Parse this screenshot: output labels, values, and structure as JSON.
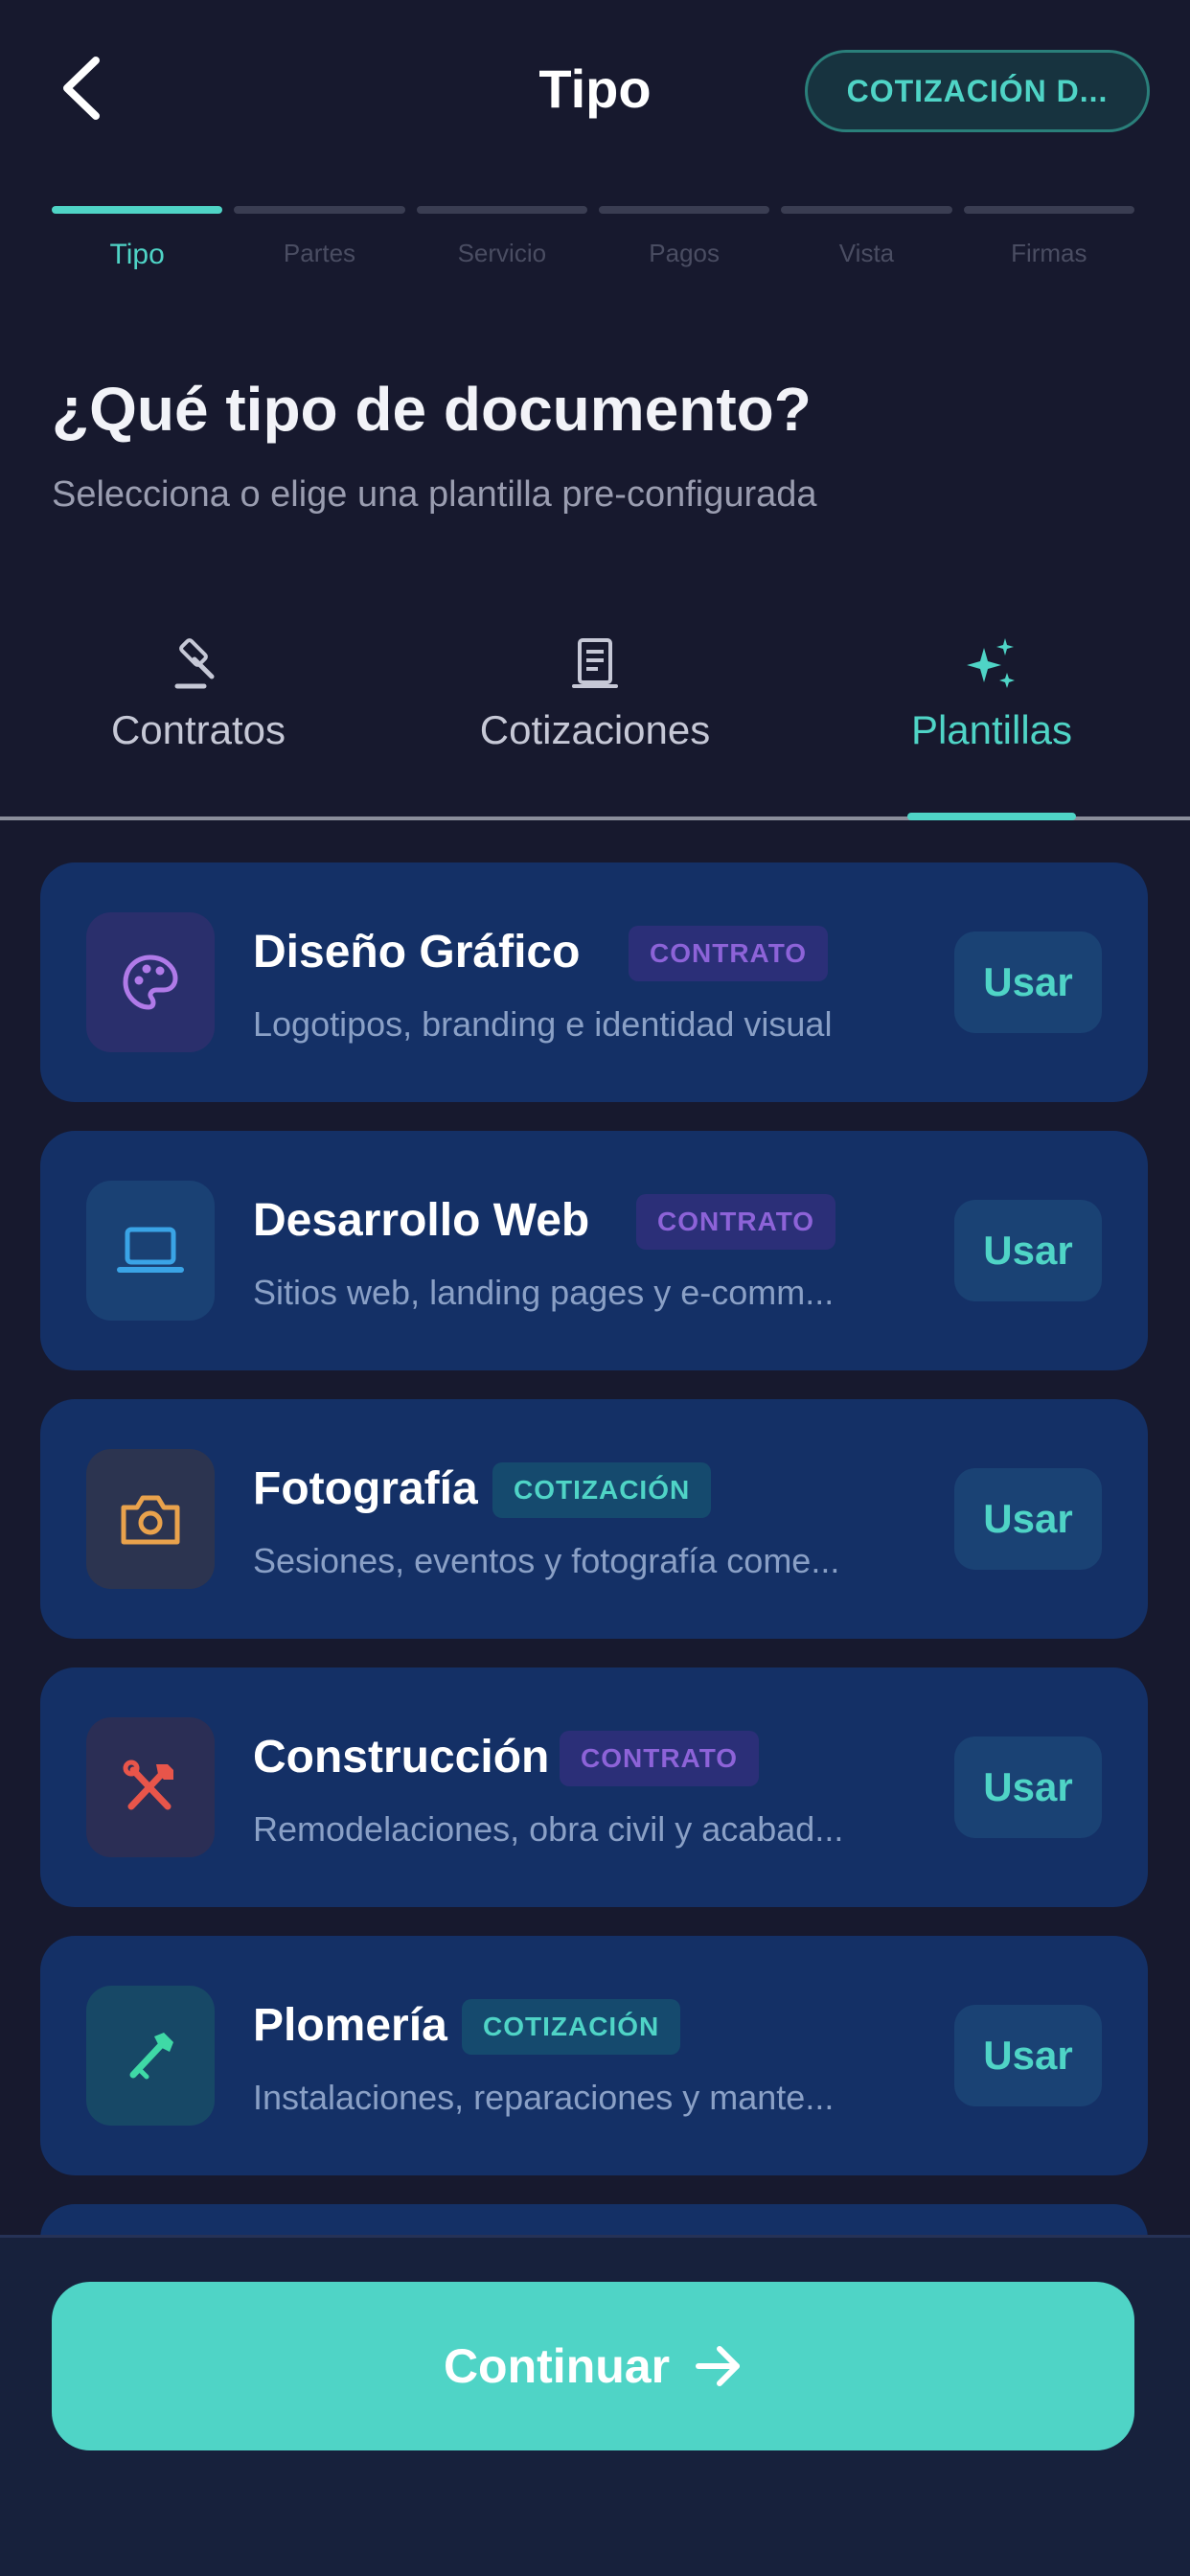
{
  "header": {
    "title": "Tipo",
    "doc_pill": "COTIZACIÓN D..."
  },
  "stepper": {
    "steps": [
      "Tipo",
      "Partes",
      "Servicio",
      "Pagos",
      "Vista",
      "Firmas"
    ],
    "active_index": 0
  },
  "intro": {
    "heading": "¿Qué tipo de documento?",
    "subheading": "Selecciona o elige una plantilla pre-configurada"
  },
  "tabs": [
    {
      "label": "Contratos",
      "icon": "gavel-icon"
    },
    {
      "label": "Cotizaciones",
      "icon": "document-icon"
    },
    {
      "label": "Plantillas",
      "icon": "sparkles-icon",
      "active": true
    }
  ],
  "templates": [
    {
      "title": "Diseño Gráfico",
      "badge": "CONTRATO",
      "desc": "Logotipos, branding e identidad visual",
      "icon": "palette-icon",
      "action": "Usar"
    },
    {
      "title": "Desarrollo Web",
      "badge": "CONTRATO",
      "desc": "Sitios web, landing pages y e-comm...",
      "icon": "laptop-icon",
      "action": "Usar"
    },
    {
      "title": "Fotografía",
      "badge": "COTIZACIÓN",
      "desc": "Sesiones, eventos y fotografía come...",
      "icon": "camera-icon",
      "action": "Usar"
    },
    {
      "title": "Construcción",
      "badge": "CONTRATO",
      "desc": "Remodelaciones, obra civil y acabad...",
      "icon": "tools-icon",
      "action": "Usar"
    },
    {
      "title": "Plomería",
      "badge": "COTIZACIÓN",
      "desc": "Instalaciones, reparaciones y mante...",
      "icon": "wrench-icon",
      "action": "Usar"
    }
  ],
  "footer": {
    "continue_label": "Continuar"
  },
  "colors": {
    "accent": "#4fd4c6",
    "background": "#17192e",
    "card": "#143066",
    "contrato_badge": "#8d63d8"
  }
}
